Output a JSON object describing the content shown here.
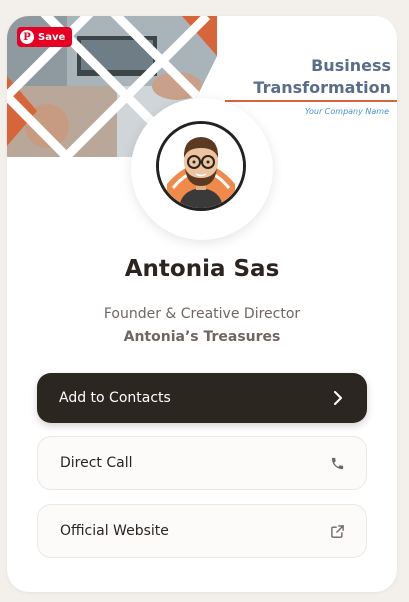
{
  "banner": {
    "title_line1": "Business",
    "title_line2": "Transformation",
    "subtitle": "Your Company Name",
    "save_label": "Save",
    "colors": {
      "title": "#5a6e8c",
      "accent_line": "#d8643a",
      "subtitle": "#4a8fd6"
    }
  },
  "profile": {
    "name": "Antonia Sas",
    "role": "Founder & Creative Director",
    "company": "Antonia’s Treasures"
  },
  "actions": {
    "add_contacts": {
      "label": "Add to Contacts",
      "icon": "chevron-right-icon"
    },
    "direct_call": {
      "label": "Direct Call",
      "icon": "phone-icon"
    },
    "website": {
      "label": "Official Website",
      "icon": "external-link-icon"
    }
  },
  "colors": {
    "page_bg": "#f3efea",
    "card_bg": "#ffffff",
    "primary_button": "#2c2620",
    "text_dark": "#2b2420",
    "text_muted": "#6f6661",
    "pinterest_red": "#e60023"
  }
}
